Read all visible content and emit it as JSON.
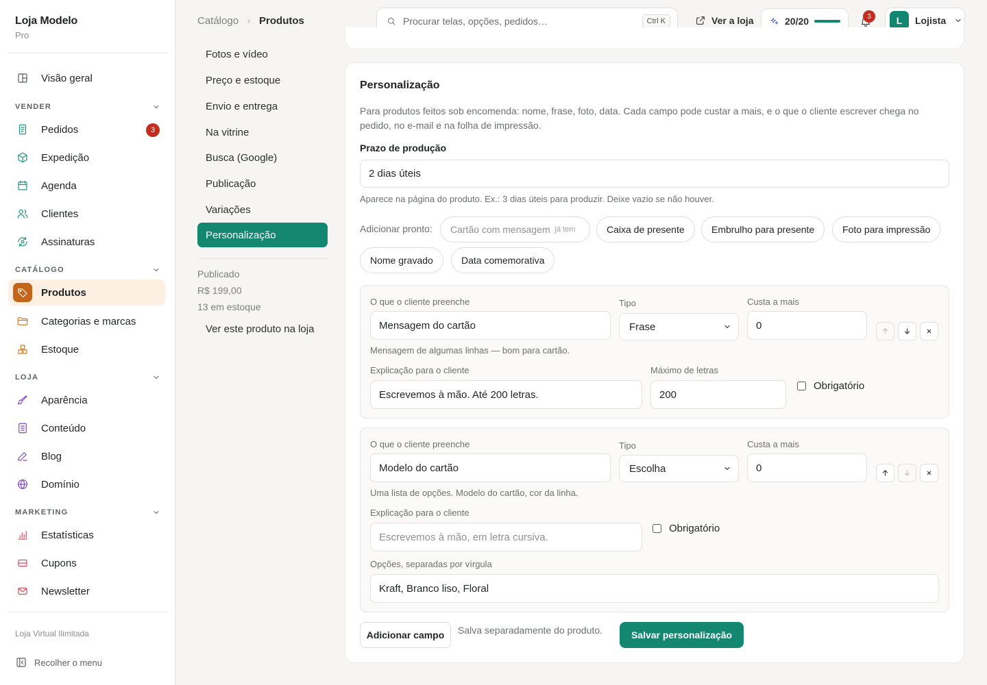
{
  "brand": {
    "name": "Loja Modelo",
    "plan": "Pro"
  },
  "sidebar": {
    "overview": "Visão geral",
    "sections": {
      "vender": "VENDER",
      "catalogo": "CATÁLOGO",
      "loja": "LOJA",
      "marketing": "MARKETING"
    },
    "items": {
      "pedidos": "Pedidos",
      "pedidos_badge": "3",
      "expedicao": "Expedição",
      "agenda": "Agenda",
      "clientes": "Clientes",
      "assinaturas": "Assinaturas",
      "produtos": "Produtos",
      "categorias": "Categorias e marcas",
      "estoque": "Estoque",
      "aparencia": "Aparência",
      "conteudo": "Conteúdo",
      "blog": "Blog",
      "dominio": "Domínio",
      "estatisticas": "Estatísticas",
      "cupons": "Cupons",
      "newsletter": "Newsletter"
    },
    "footer_note": "Loja Virtual Ilimitada",
    "collapse": "Recolher o menu"
  },
  "topbar": {
    "breadcrumb": [
      "Catálogo",
      "Produtos"
    ],
    "search_placeholder": "Procurar telas, opções, pedidos…",
    "search_shortcut": "Ctrl K",
    "view_store": "Ver a loja",
    "score": "20/20",
    "score_fraction": 1.0,
    "notifications": "3",
    "user_initial": "L",
    "user_name": "Lojista"
  },
  "section_nav": {
    "items": [
      "Fotos e vídeo",
      "Preço e estoque",
      "Envio e entrega",
      "Na vitrine",
      "Busca (Google)",
      "Publicação",
      "Variações",
      "Personalização"
    ],
    "active": "Personalização",
    "status": "Publicado",
    "price": "R$ 199,00",
    "stock": "13 em estoque",
    "view_link": "Ver este produto na loja"
  },
  "personalizacao": {
    "title": "Personalização",
    "description": "Para produtos feitos sob encomenda: nome, frase, foto, data. Cada campo pode custar a mais, e o que o cliente escrever chega no pedido, no e-mail e na folha de impressão.",
    "prazo_label": "Prazo de produção",
    "prazo_value": "2 dias úteis",
    "prazo_help": "Aparece na página do produto. Ex.: 3 dias úteis para produzir. Deixe vazio se não houver.",
    "presets_label": "Adicionar pronto:",
    "presets": [
      {
        "label": "Cartão com mensagem",
        "tag": "já tem"
      },
      {
        "label": "Caixa de presente"
      },
      {
        "label": "Embrulho para presente"
      },
      {
        "label": "Foto para impressão"
      },
      {
        "label": "Nome gravado"
      },
      {
        "label": "Data comemorativa"
      }
    ],
    "labels": {
      "field_name": "O que o cliente preenche",
      "type": "Tipo",
      "extra_cost": "Custa a mais",
      "explanation": "Explicação para o cliente",
      "max_letters": "Máximo de letras",
      "required": "Obrigatório",
      "options": "Opções, separadas por vírgula"
    },
    "fields": [
      {
        "name": "Mensagem do cartão",
        "type": "Frase",
        "cost": "0",
        "hint": "Mensagem de algumas linhas — bom para cartão.",
        "explanation": "Escrevemos à mão. Até 200 letras.",
        "max_letters": "200",
        "required": false
      },
      {
        "name": "Modelo do cartão",
        "type": "Escolha",
        "cost": "0",
        "hint": "Uma lista de opções. Modelo do cartão, cor da linha.",
        "explanation_placeholder": "Escrevemos à mão, em letra cursiva.",
        "required": false,
        "options": "Kraft, Branco liso, Floral"
      }
    ],
    "add_field": "Adicionar campo",
    "save_note": "Salva separadamente do produto.",
    "save_button": "Salvar personalização"
  }
}
